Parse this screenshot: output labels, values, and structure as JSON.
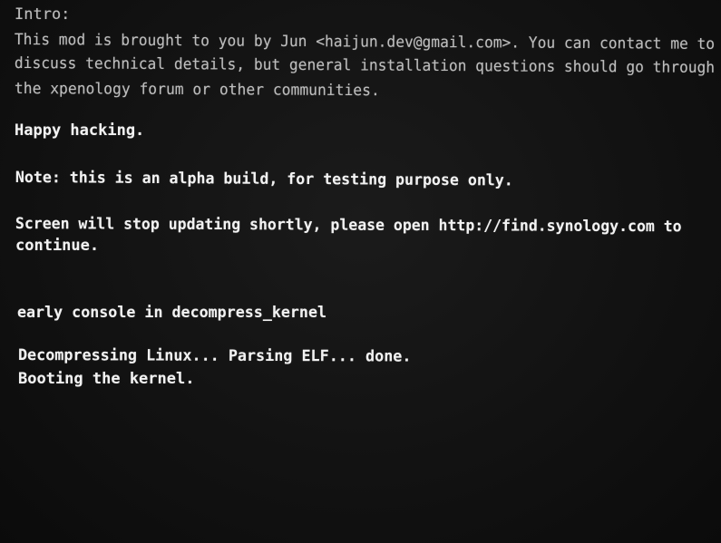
{
  "console": {
    "intro_heading": "Intro:",
    "intro_line1": "This mod is brought to you by Jun <haijun.dev@gmail.com>. You can contact me to",
    "intro_line2": "discuss technical details, but general installation questions should go through",
    "intro_line3": "the xpenology forum or other communities.",
    "happy": "Happy hacking.",
    "note": "Note: this is an alpha build, for testing purpose only.",
    "screen_line1": "Screen will stop updating shortly, please open http://find.synology.com to",
    "screen_line2": "continue.",
    "early_console": "early console in decompress_kernel",
    "decompress": "Decompressing Linux... Parsing ELF... done.",
    "booting": "Booting the kernel."
  }
}
